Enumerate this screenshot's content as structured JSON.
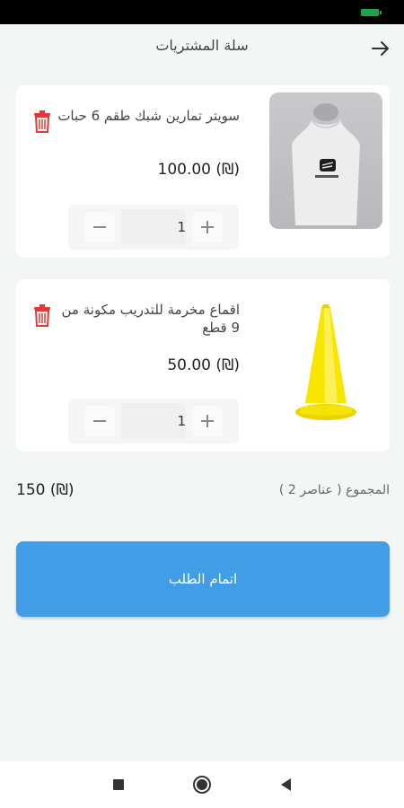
{
  "header": {
    "title": "سلة المشتريات",
    "back_icon": "arrow-right-icon"
  },
  "cart": {
    "items": [
      {
        "title": "سويتر تمارين شبك طقم 6 حبات",
        "price": "100.00 (₪)",
        "quantity": "1",
        "image": "training-vest-image"
      },
      {
        "title": "اقماع مخرمة للتدريب مكونة من 9 قطع",
        "price": "50.00 (₪)",
        "quantity": "1",
        "image": "training-cone-image"
      }
    ],
    "total_label": "المجموع ( عناصر 2 )",
    "total_value": "150 (₪)"
  },
  "checkout": {
    "label": "اتمام الطلب"
  },
  "colors": {
    "accent": "#419de6",
    "delete": "#e53935",
    "background": "#f4f5f5",
    "battery": "#1fa34a"
  }
}
